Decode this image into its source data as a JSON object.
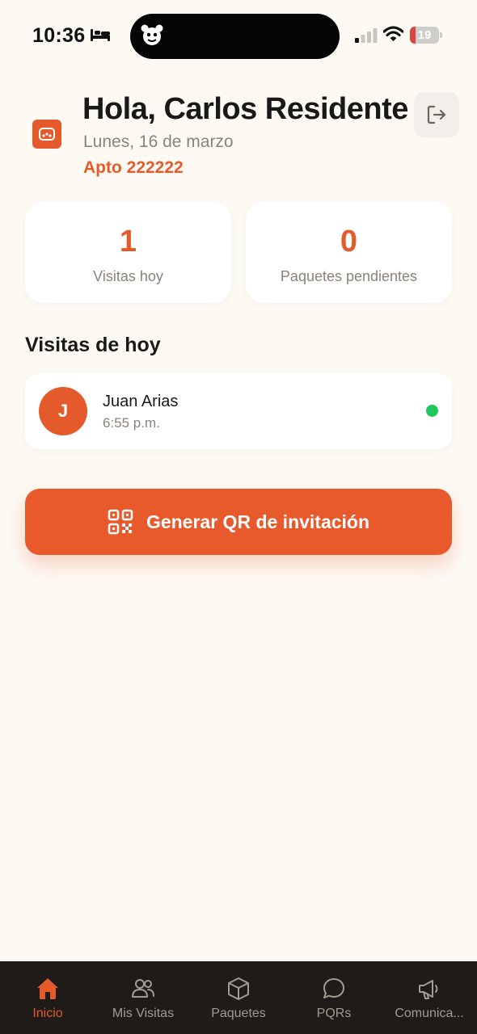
{
  "status_bar": {
    "time": "10:36",
    "battery": "19",
    "battery_level": 0.19
  },
  "header": {
    "greeting": "Hola, Carlos Residente",
    "date": "Lunes, 16 de marzo",
    "apartment": "Apto 222222"
  },
  "stats": [
    {
      "value": "1",
      "label": "Visitas hoy"
    },
    {
      "value": "0",
      "label": "Paquetes pendientes"
    }
  ],
  "visits_section": {
    "title": "Visitas de hoy",
    "items": [
      {
        "initial": "J",
        "name": "Juan Arias",
        "time": "6:55 p.m.",
        "status_color": "#22c55e"
      }
    ]
  },
  "qr_button": {
    "label": "Generar QR de invitación"
  },
  "bottom_nav": {
    "items": [
      {
        "label": "Inicio",
        "icon": "home-icon",
        "active": true
      },
      {
        "label": "Mis Visitas",
        "icon": "users-icon",
        "active": false
      },
      {
        "label": "Paquetes",
        "icon": "package-icon",
        "active": false
      },
      {
        "label": "PQRs",
        "icon": "chat-icon",
        "active": false
      },
      {
        "label": "Comunica...",
        "icon": "megaphone-icon",
        "active": false
      }
    ]
  },
  "colors": {
    "accent": "#e55a2b",
    "background": "#fdfaf4",
    "nav_background": "#1e1b18",
    "nav_inactive": "#a39b92",
    "online": "#22c55e"
  }
}
